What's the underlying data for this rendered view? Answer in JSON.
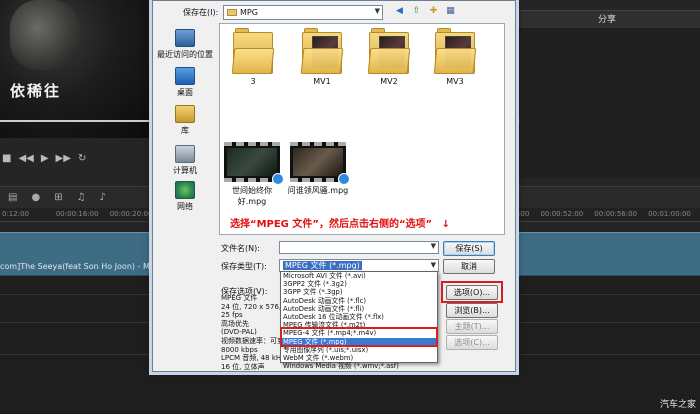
{
  "background": {
    "subtitle": "依稀往",
    "share_tab": "分享",
    "timeline_ticks": [
      "0:12:00",
      "00:00:16:00",
      "00:00:20:00",
      "00:00:24:00",
      "00:00:28:00",
      "00:00:32:00",
      "00:00:36:00",
      "00:00:40:00",
      "00:00:44:00",
      "00:00:48:00",
      "00:00:52:00",
      "00:00:56:00",
      "00:01:00:00"
    ],
    "clip_label": "com]The Seeya(feat Son Ho Joon) - M",
    "right_dim_1": "ᴍ",
    "right_dim_2": "4"
  },
  "dialog": {
    "save_in_label": "保存在(I):",
    "save_in_value": "MPG",
    "places": [
      {
        "label": "最近访问的位置",
        "icon": "recent-icon"
      },
      {
        "label": "桌面",
        "icon": "desktop-icon"
      },
      {
        "label": "库",
        "icon": "library-icon"
      },
      {
        "label": "计算机",
        "icon": "computer-icon"
      },
      {
        "label": "网络",
        "icon": "network-icon"
      }
    ],
    "folders": [
      "3",
      "MV1",
      "MV2",
      "MV3"
    ],
    "videos": [
      "世间始终你好.mpg",
      "问谁领风骚.mpg"
    ],
    "instruction": "选择“MPEG 文件”，然后点击右侧的“选项”",
    "instruction_arrow": "↓",
    "filename_label": "文件名(N):",
    "filename_value": "",
    "filetype_label": "保存类型(T):",
    "filetype_value": "MPEG 文件 (*.mpg)",
    "save_options_label": "保存选项(V):",
    "save_options": [
      "MPEG 文件",
      "24 位, 720 x 576, 25 fps",
      "高场优先",
      "(DVD-PAL)",
      "视频数据速率：可变",
      "8000 kbps",
      "LPCM 音频, 48 kHz, 16 位, 立体声"
    ],
    "file_types": [
      "Microsoft AVI 文件 (*.avi)",
      "3GPP2 文件 (*.3g2)",
      "3GPP 文件 (*.3gp)",
      "AutoDesk 动画文件 (*.flc)",
      "AutoDesk 动画文件 (*.fli)",
      "AutoDesk 16 位动画文件 (*.flx)",
      "MPEG 传输流文件 (*.m2t)",
      "MPEG-4 文件 (*.mp4;*.m4v)",
      "MPEG 文件 (*.mpg)",
      "专用图像序列 (*.uis;*.uisx)",
      "WebM 文件 (*.webm)",
      "Windows Media 视频 (*.wmv;*.asf)"
    ],
    "selected_file_type_index": 8,
    "buttons": {
      "save": "保存(S)",
      "cancel": "取消",
      "options": "选项(O)...",
      "browse": "浏览(B)...",
      "theme": "主题(T)...",
      "template": "选项(C)..."
    }
  },
  "watermark": "汽车之家"
}
